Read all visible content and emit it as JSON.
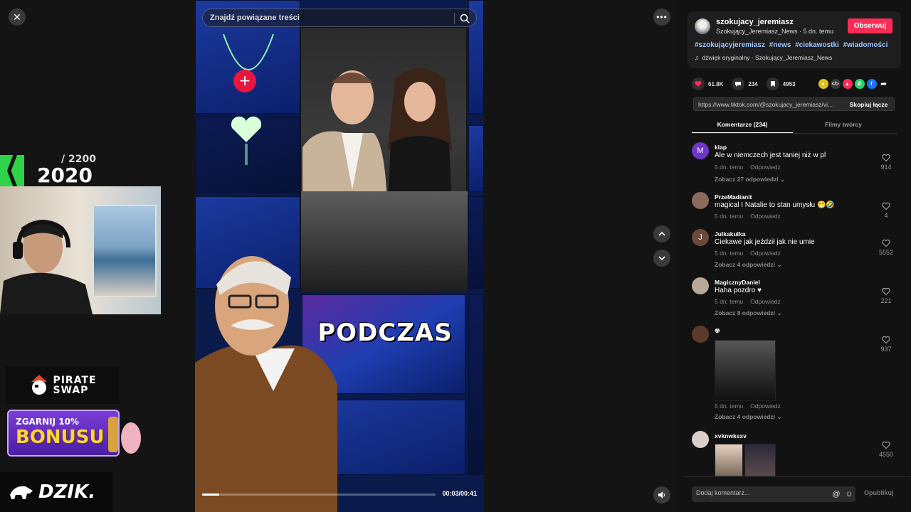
{
  "search": {
    "placeholder": "Znajdź powiązane treści"
  },
  "video": {
    "overlay_text": "PODCZAS",
    "time": "00:03/00:41",
    "progress": 0.073
  },
  "overlay": {
    "counter": "/ 2200",
    "year": "2020"
  },
  "sponsors": {
    "pirate_line1": "PIRATE",
    "pirate_line2": "SWAP",
    "bonus_line1": "ZGARNIJ 10%",
    "bonus_line2": "BONUSU",
    "dzik": "DZIK."
  },
  "author": {
    "username": "szokujacy_jeremiasz",
    "subtitle": "Szokujący_Jeremiasz_News · 5 dn. temu",
    "follow_label": "Obserwuj",
    "hashtags": [
      "#szokującyjeremiasz",
      "#news",
      "#ciekawostki",
      "#wiadomości"
    ],
    "sound": "dźwięk oryginalny - Szokujący_Jeremiasz_News"
  },
  "stats": {
    "likes": "61.8K",
    "comments": "234",
    "saves": "4953"
  },
  "share": {
    "url": "https://www.tiktok.com/@szokujacy_jeremiasz/vi...",
    "copy_label": "Skopiuj łącze"
  },
  "tabs": {
    "comments": "Komentarze (234)",
    "creator": "Filmy twórcy"
  },
  "comments": [
    {
      "user": "klap",
      "avatar_letter": "M",
      "avatar_color": "#6c36c9",
      "text": "Ale w niemczech jest taniej niż w pl",
      "time": "5 dn. temu",
      "reply": "Odpowiedz",
      "more": "Zobacz 27 odpowiedzi",
      "likes": "914"
    },
    {
      "user": "PrzeMadianit",
      "avatar_letter": "",
      "avatar_color": "#8a6a5a",
      "text": "magical I Natalie to stan umysłu 😁🤣",
      "time": "5 dn. temu",
      "reply": "Odpowiedz",
      "more": "",
      "likes": "4"
    },
    {
      "user": "Julkakulka",
      "avatar_letter": "J",
      "avatar_color": "#6a4a3a",
      "text": "Ciekawe jak jeździł jak nie umie",
      "time": "5 dn. temu",
      "reply": "Odpowiedz",
      "more": "Zobacz 4 odpowiedzi",
      "likes": "5552"
    },
    {
      "user": "MagicznyDaniel",
      "avatar_letter": "",
      "avatar_color": "#b8a898",
      "text": "Haha pozdro ♥",
      "time": "5 dn. temu",
      "reply": "Odpowiedz",
      "more": "Zobacz 8 odpowiedzi",
      "likes": "221"
    },
    {
      "user": "☢",
      "avatar_letter": "",
      "avatar_color": "#5a3a2a",
      "text": "",
      "time": "5 dn. temu",
      "reply": "Odpowiedz",
      "more": "Zobacz 4 odpowiedzi",
      "likes": "937"
    },
    {
      "user": "xvknwksxv",
      "avatar_letter": "",
      "avatar_color": "#d8d0c8",
      "text": "",
      "time": "",
      "reply": "",
      "more": "",
      "likes": "4550"
    }
  ],
  "composer": {
    "placeholder": "Dodaj komentarz...",
    "publish": "Opublikuj"
  }
}
